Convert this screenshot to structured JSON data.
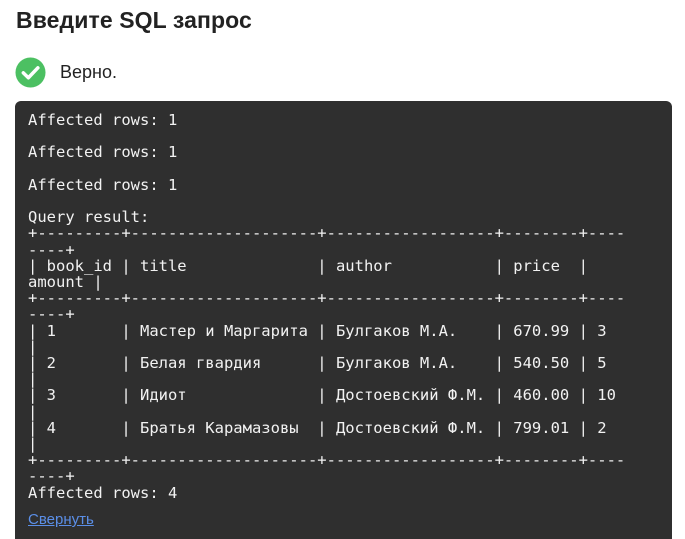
{
  "page": {
    "title": "Введите SQL запрос"
  },
  "status": {
    "icon": "check-circle-icon",
    "text": "Верно.",
    "color": "#4cc062"
  },
  "console": {
    "output": "Affected rows: 1\n\nAffected rows: 1\n\nAffected rows: 1\n\nQuery result:\n+---------+--------------------+------------------+--------+----\n----+\n| book_id | title              | author           | price  |\namount |\n+---------+--------------------+------------------+--------+----\n----+\n| 1       | Мастер и Маргарита | Булгаков М.А.    | 670.99 | 3\n|\n| 2       | Белая гвардия      | Булгаков М.А.    | 540.50 | 5\n|\n| 3       | Идиот              | Достоевский Ф.М. | 460.00 | 10\n|\n| 4       | Братья Карамазовы  | Достоевский Ф.М. | 799.01 | 2\n|\n+---------+--------------------+------------------+--------+----\n----+\nAffected rows: 4",
    "collapse_label": "Свернуть",
    "background": "#2f2f2f",
    "link_color": "#5b8fe8"
  }
}
